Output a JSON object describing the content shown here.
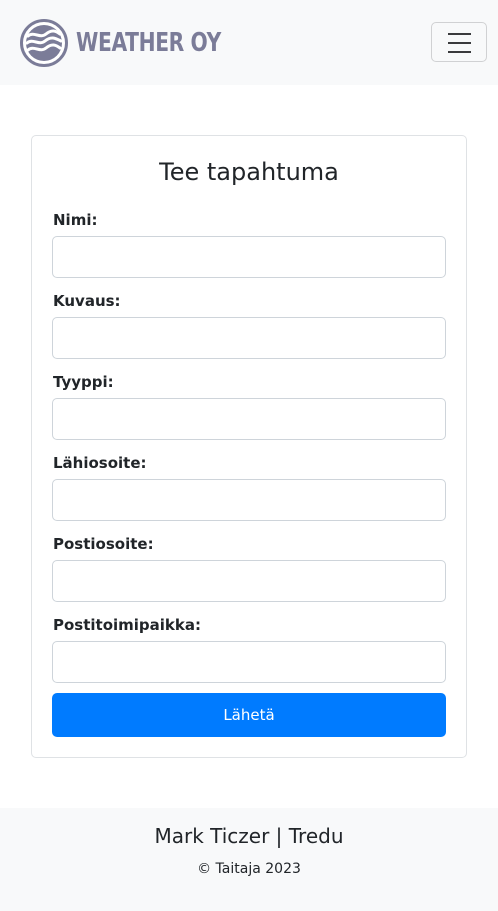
{
  "navbar": {
    "brand_text": "WEATHER OY",
    "logo_icon": "wave-logo-icon",
    "toggler_icon": "hamburger-menu-icon",
    "brand_color": "#7b7c98"
  },
  "form": {
    "title": "Tee tapahtuma",
    "fields": [
      {
        "label": "Nimi:",
        "value": "",
        "placeholder": ""
      },
      {
        "label": "Kuvaus:",
        "value": "",
        "placeholder": ""
      },
      {
        "label": "Tyyppi:",
        "value": "",
        "placeholder": ""
      },
      {
        "label": "Lähiosoite:",
        "value": "",
        "placeholder": ""
      },
      {
        "label": "Postiosoite:",
        "value": "",
        "placeholder": ""
      },
      {
        "label": "Postitoimipaikka:",
        "value": "",
        "placeholder": ""
      }
    ],
    "submit_label": "Lähetä",
    "accent_color": "#007bff"
  },
  "footer": {
    "name": "Mark Ticzer | Tredu",
    "copyright": "© Taitaja 2023"
  }
}
